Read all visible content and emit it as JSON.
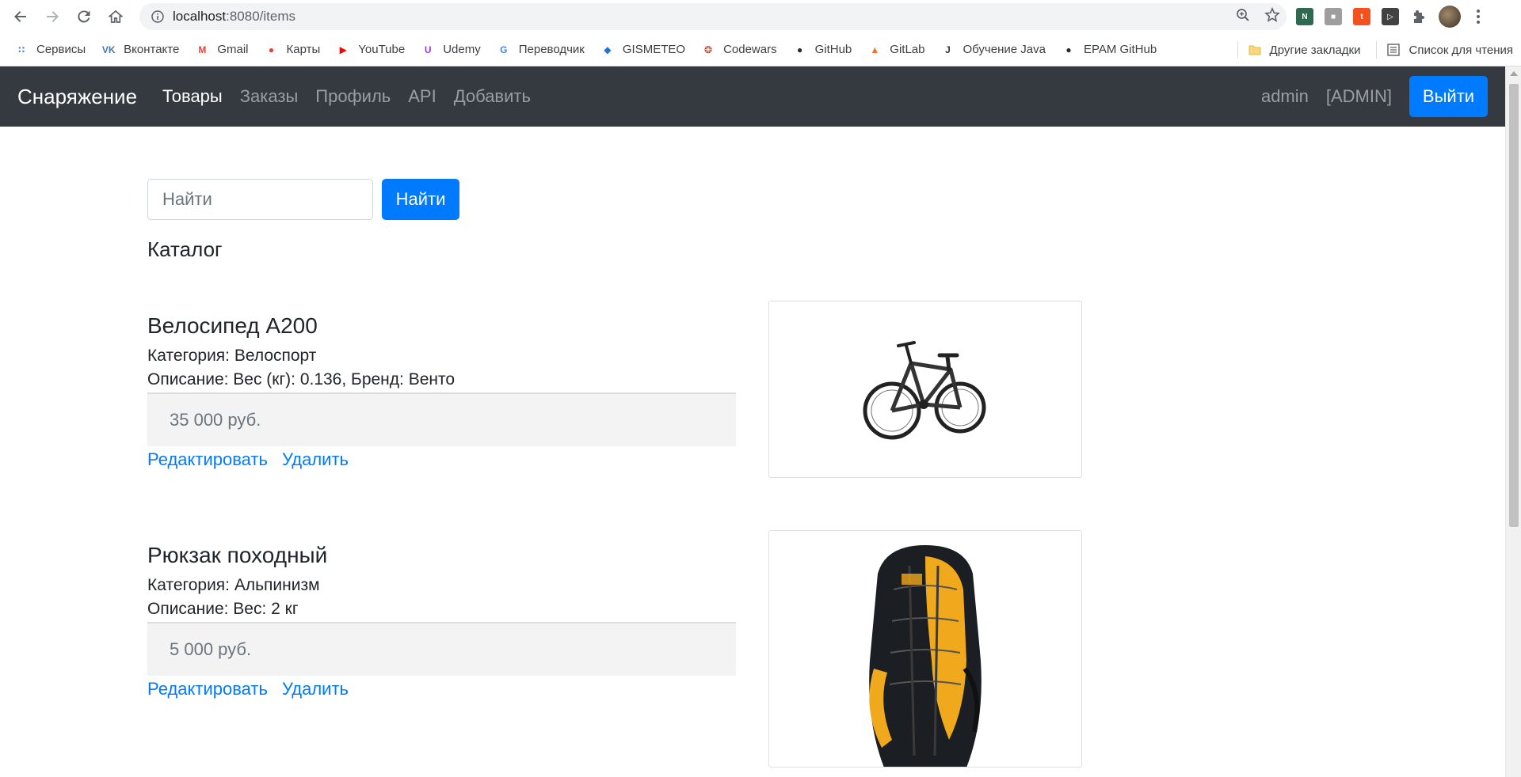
{
  "browser": {
    "url_host": "localhost",
    "url_path": ":8080/items",
    "bookmarks": [
      {
        "label": "Сервисы",
        "icon": "apps-grid-icon",
        "color": "#4285f4"
      },
      {
        "label": "Вконтакте",
        "icon": "vk-icon",
        "color": "#4a76a8"
      },
      {
        "label": "Gmail",
        "icon": "gmail-icon",
        "color": "#ea4335"
      },
      {
        "label": "Карты",
        "icon": "maps-pin-icon",
        "color": "#ea4335"
      },
      {
        "label": "YouTube",
        "icon": "youtube-icon",
        "color": "#ff0000"
      },
      {
        "label": "Udemy",
        "icon": "udemy-icon",
        "color": "#a435f0"
      },
      {
        "label": "Переводчик",
        "icon": "translate-icon",
        "color": "#4285f4"
      },
      {
        "label": "GISMETEO",
        "icon": "gismeteo-icon",
        "color": "#1a73e8"
      },
      {
        "label": "Codewars",
        "icon": "codewars-icon",
        "color": "#b1361e"
      },
      {
        "label": "GitHub",
        "icon": "github-icon",
        "color": "#24292e"
      },
      {
        "label": "GitLab",
        "icon": "gitlab-icon",
        "color": "#fc6d26"
      },
      {
        "label": "Обучение Java",
        "icon": "java-icon",
        "color": "#333333"
      },
      {
        "label": "EPAM GitHub",
        "icon": "github-icon",
        "color": "#24292e"
      }
    ],
    "other_bookmarks": "Другие закладки",
    "reading_list": "Список для чтения"
  },
  "navbar": {
    "brand": "Снаряжение",
    "links": [
      "Товары",
      "Заказы",
      "Профиль",
      "API",
      "Добавить"
    ],
    "active_link": "Товары",
    "user": "admin",
    "role": "[ADMIN]",
    "logout": "Выйти"
  },
  "search": {
    "placeholder": "Найти",
    "button": "Найти"
  },
  "catalog_title": "Каталог",
  "items": [
    {
      "title": "Велосипед А200",
      "category": "Категория: Велоспорт",
      "description": "Описание: Вес (кг): 0.136, Бренд: Венто",
      "price": "35 000 руб.",
      "edit": "Редактировать",
      "delete": "Удалить"
    },
    {
      "title": "Рюкзак походный",
      "category": "Категория: Альпинизм",
      "description": "Описание: Вес: 2 кг",
      "price": "5 000 руб.",
      "edit": "Редактировать",
      "delete": "Удалить"
    }
  ],
  "colors": {
    "navbar_bg": "#343a40",
    "primary": "#007bff"
  }
}
